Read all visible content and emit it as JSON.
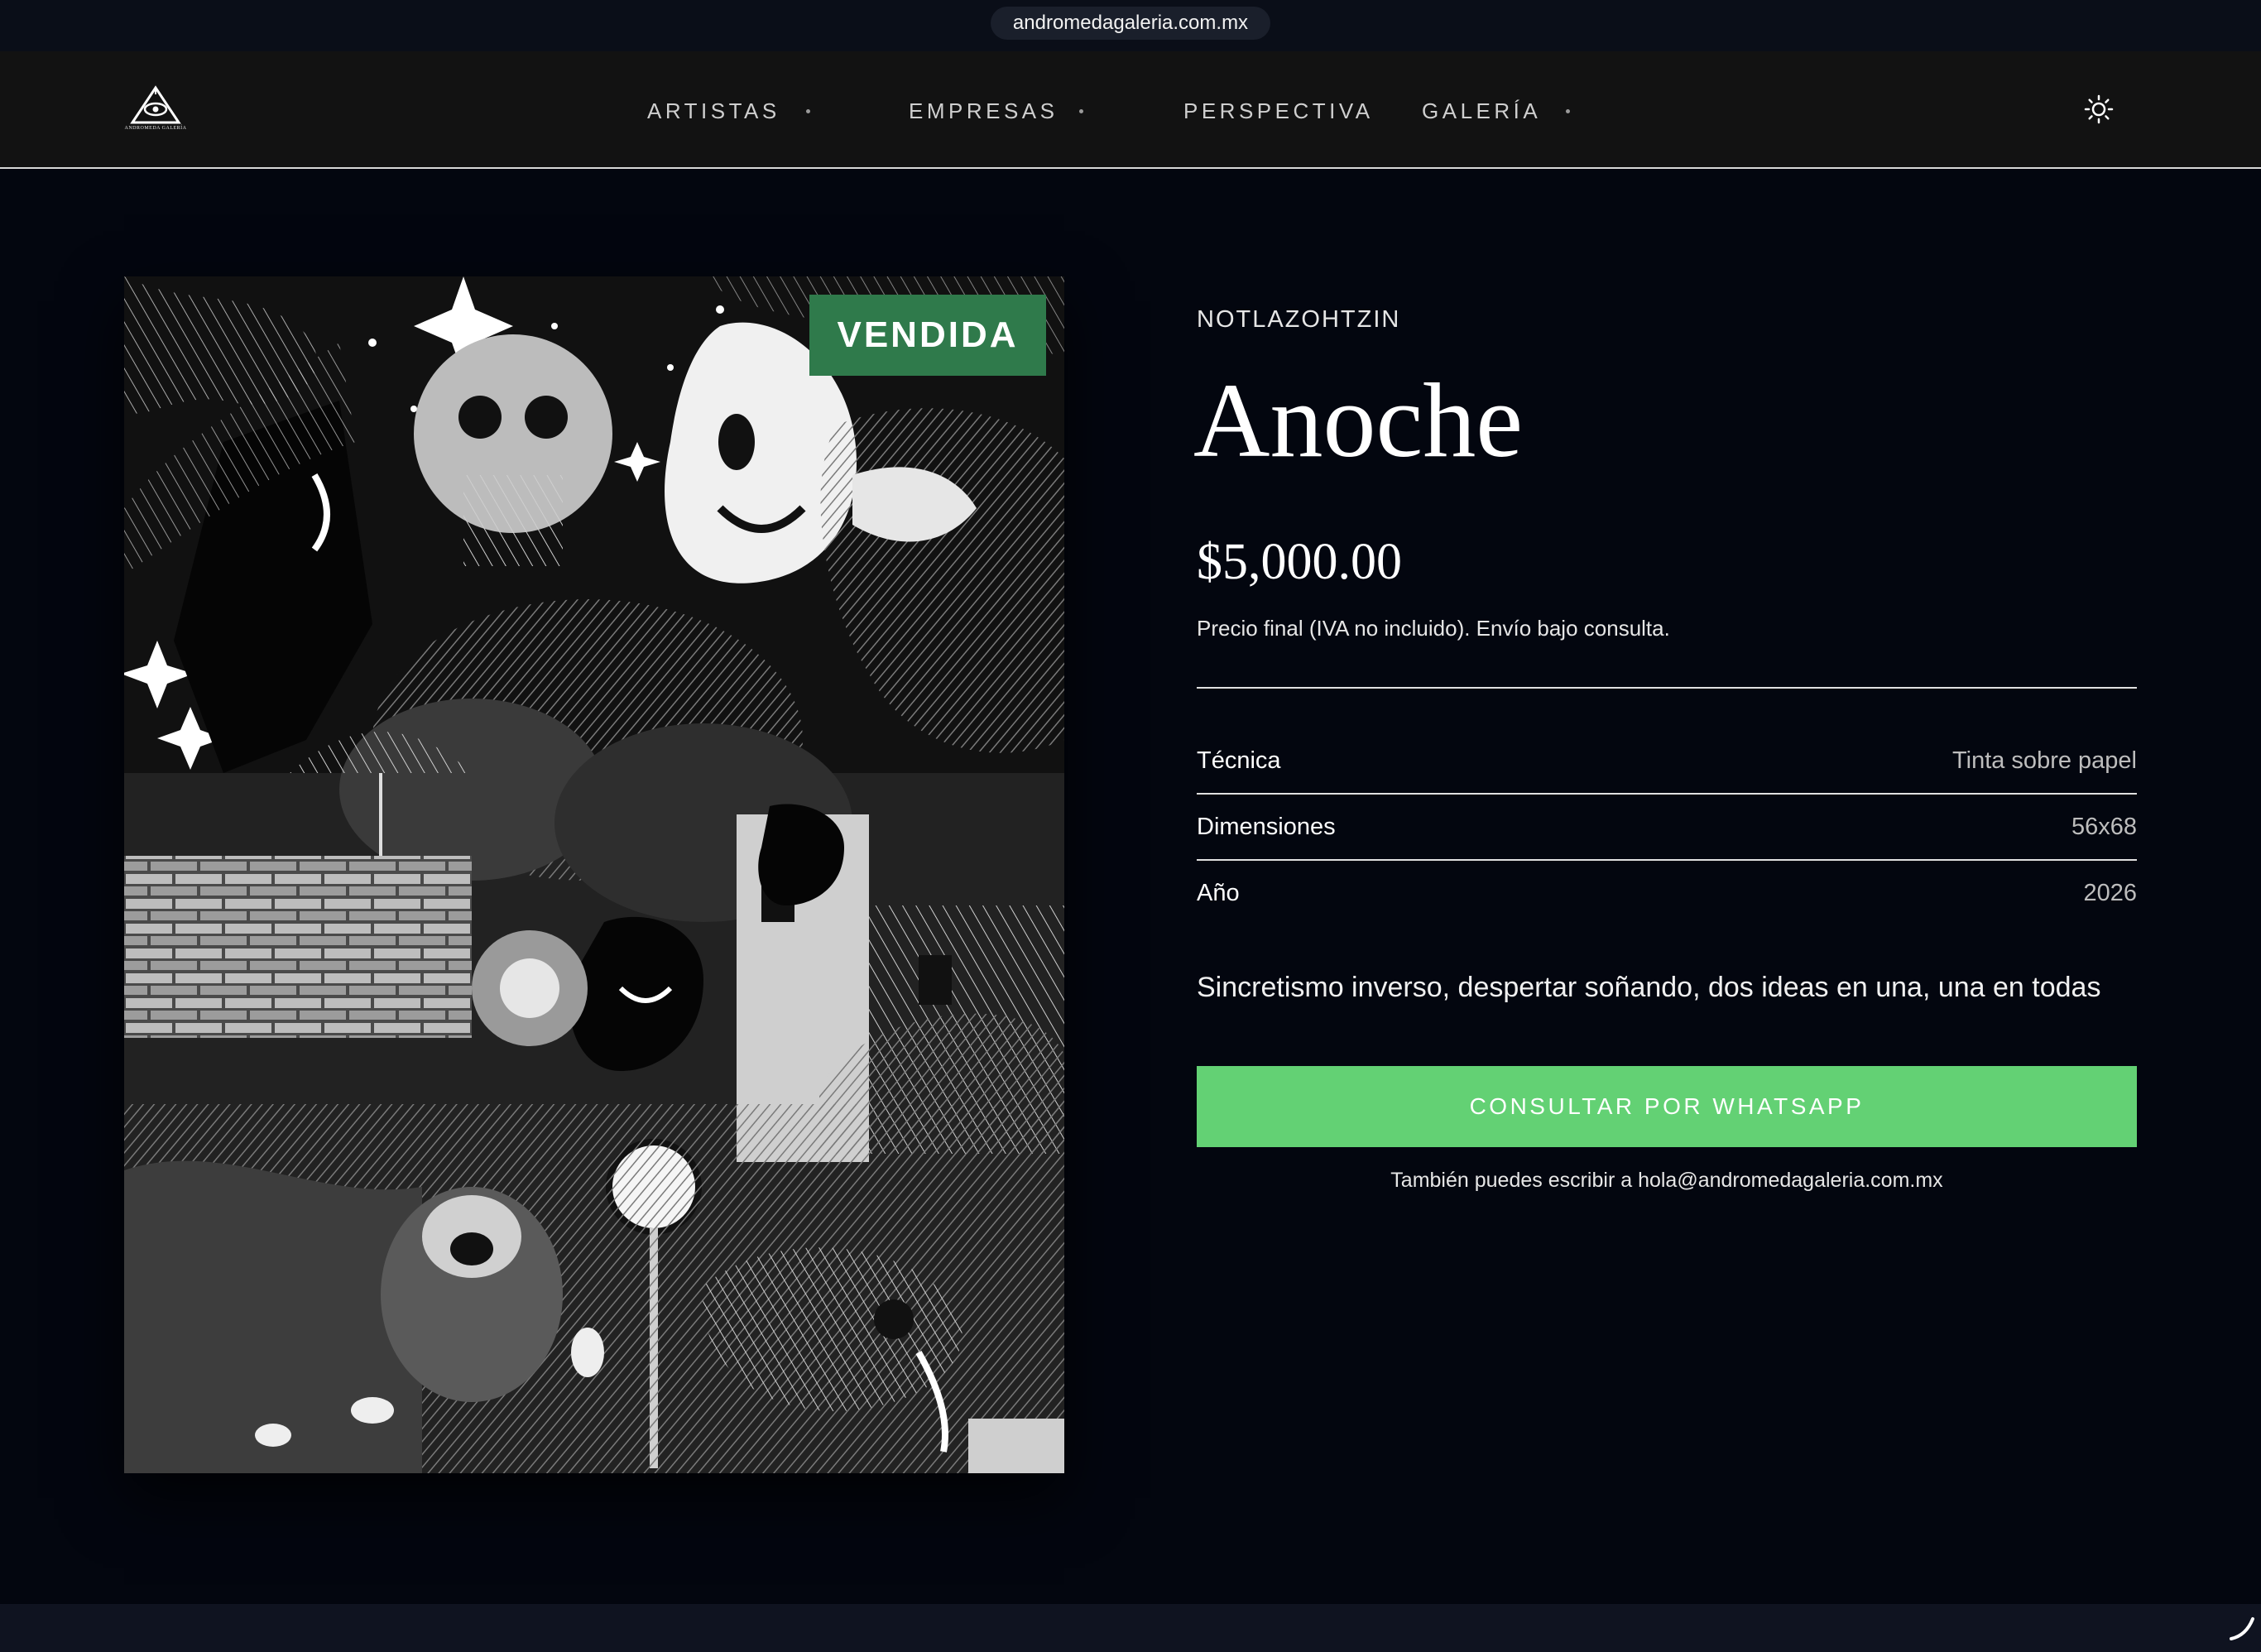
{
  "browser": {
    "url": "andromedagaleria.com.mx"
  },
  "header": {
    "logo_text": "ANDROMEDA GALERÍA",
    "nav": [
      {
        "label": "ARTISTAS",
        "has_dropdown": true
      },
      {
        "label": "EMPRESAS",
        "has_dropdown": true
      },
      {
        "label": "PERSPECTIVA",
        "has_dropdown": false
      },
      {
        "label": "GALERÍA",
        "has_dropdown": true
      }
    ],
    "theme_toggle_icon": "sun-icon"
  },
  "artwork": {
    "badge": "VENDIDA",
    "badge_color": "#2f7a4b"
  },
  "details": {
    "artist": "NOTLAZOHTZIN",
    "title": "Anoche",
    "price": "$5,000.00",
    "price_note": "Precio final (IVA no incluido). Envío bajo consulta.",
    "specs": [
      {
        "label": "Técnica",
        "value": "Tinta sobre papel"
      },
      {
        "label": "Dimensiones",
        "value": "56x68"
      },
      {
        "label": "Año",
        "value": "2026"
      }
    ],
    "description": "Sincretismo inverso, despertar soñando, dos ideas en una, una en todas",
    "cta_label": "CONSULTAR POR WHATSAPP",
    "cta_color": "#63d174",
    "email_note": "También puedes escribir a hola@andromedagaleria.com.mx"
  },
  "colors": {
    "background": "#03060f",
    "header_background": "#121212"
  }
}
